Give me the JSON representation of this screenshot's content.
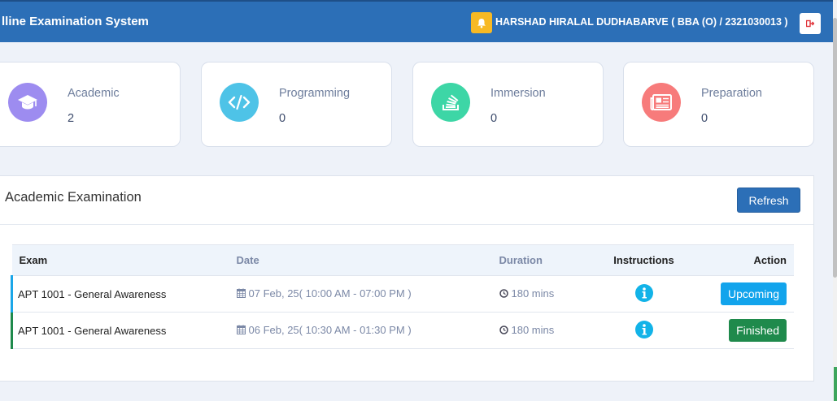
{
  "header": {
    "app_title": "lline Examination System",
    "user_label": "HARSHAD HIRALAL DUDHABARVE ( BBA (O) / 2321030013 )",
    "bell_icon": "bell-icon",
    "logout_icon": "logout-icon"
  },
  "stats": [
    {
      "label": "Academic",
      "value": "2",
      "icon": "graduation-cap-icon",
      "color": "#9d8cf0"
    },
    {
      "label": "Programming",
      "value": "0",
      "icon": "code-icon",
      "color": "#4ec3e7"
    },
    {
      "label": "Immersion",
      "value": "0",
      "icon": "stack-icon",
      "color": "#3dd6a6"
    },
    {
      "label": "Preparation",
      "value": "0",
      "icon": "newspaper-icon",
      "color": "#f77b7b"
    }
  ],
  "panel": {
    "title": "Academic Examination",
    "refresh_label": "Refresh"
  },
  "table": {
    "headers": {
      "exam": "Exam",
      "date": "Date",
      "duration": "Duration",
      "instructions": "Instructions",
      "action": "Action"
    },
    "rows": [
      {
        "exam": "APT 1001 - General Awareness",
        "date": "07 Feb, 25( 10:00 AM - 07:00 PM )",
        "duration": "180 mins",
        "action": "Upcoming",
        "status_color": "#12a4ec"
      },
      {
        "exam": "APT 1001 - General Awareness",
        "date": "06 Feb, 25( 10:30 AM - 01:30 PM )",
        "duration": "180 mins",
        "action": "Finished",
        "status_color": "#1f8a4c"
      }
    ]
  }
}
